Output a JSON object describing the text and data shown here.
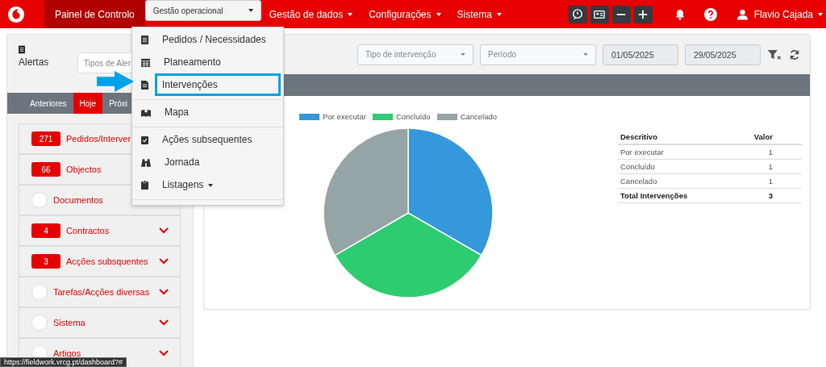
{
  "navbar": {
    "items": [
      {
        "label": "Painel de Controlo",
        "selected": false,
        "active": true
      },
      {
        "label": "Gestão operacional",
        "selected": true,
        "active": false
      },
      {
        "label": "Gestão de dados",
        "selected": false,
        "active": false
      },
      {
        "label": "Configurações",
        "selected": false,
        "active": false
      },
      {
        "label": "Sistema",
        "selected": false,
        "active": false
      }
    ],
    "user": "Flavio Cajada"
  },
  "dropdown": {
    "groups": [
      [
        {
          "label": "Pedidos / Necessidades",
          "highlighted": false,
          "caret": false
        },
        {
          "label": "Planeamento",
          "highlighted": false,
          "caret": false
        },
        {
          "label": "Intervenções",
          "highlighted": true,
          "caret": false
        }
      ],
      [
        {
          "label": "Mapa",
          "highlighted": false,
          "caret": false
        }
      ],
      [
        {
          "label": "Ações subsequentes",
          "highlighted": false,
          "caret": false
        },
        {
          "label": "Jornada",
          "highlighted": false,
          "caret": false
        },
        {
          "label": "Listagens",
          "highlighted": false,
          "caret": true
        }
      ]
    ]
  },
  "alerts": {
    "title": "Alertas",
    "type_placeholder": "Tipos de Aler",
    "tabs": [
      {
        "label": "Anteriores",
        "selected": false
      },
      {
        "label": "Hoje",
        "selected": true
      },
      {
        "label": "Próxi",
        "selected": false
      }
    ],
    "items": [
      {
        "label": "Pedidos/Interver",
        "count": "271"
      },
      {
        "label": "Objectos",
        "count": "66"
      },
      {
        "label": "Documentos"
      },
      {
        "label": "Contractos",
        "count": "4",
        "expandable": true
      },
      {
        "label": "Acções subsquentes",
        "count": "3",
        "expandable": true
      },
      {
        "label": "Tarefas/Acções diversas",
        "expandable": true
      },
      {
        "label": "Sistema",
        "expandable": true
      },
      {
        "label": "Artigos",
        "expandable": true
      }
    ]
  },
  "filters": {
    "intervention_type_placeholder": "Tipo de intervenção",
    "period_placeholder": "Período",
    "date_from": "01/05/2025",
    "date_to": "29/05/2025"
  },
  "chart_data": {
    "type": "pie",
    "legend": "top",
    "categories": [
      "Por executar",
      "Concluído",
      "Cancelado"
    ],
    "values": [
      33.33,
      33.33,
      33.34
    ],
    "colors": [
      "#3498db",
      "#2ecc71",
      "#95a5a6"
    ]
  },
  "table": {
    "columns": [
      "Descritivo",
      "Valor"
    ],
    "rows": [
      {
        "cells": [
          "Por executar",
          "1"
        ],
        "total": false
      },
      {
        "cells": [
          "Concluído",
          "1"
        ],
        "total": false
      },
      {
        "cells": [
          "Cancelado",
          "1"
        ],
        "total": false
      },
      {
        "cells": [
          "Total Intervenções",
          "3"
        ],
        "total": true
      }
    ]
  },
  "status_url": "https://fieldwork.vrcg.pt/dashboard?#"
}
